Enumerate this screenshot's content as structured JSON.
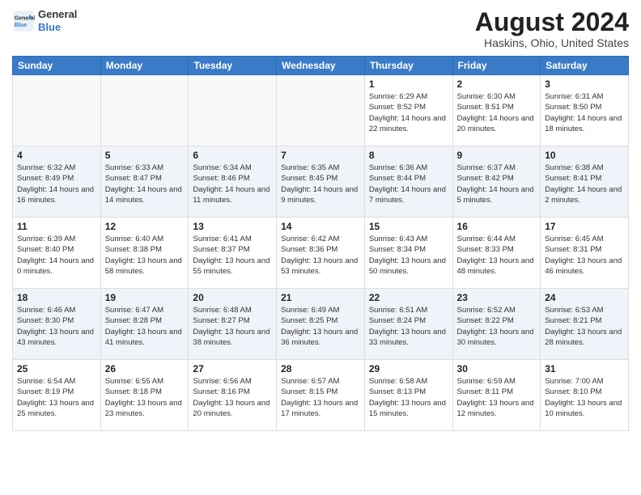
{
  "header": {
    "logo_line1": "General",
    "logo_line2": "Blue",
    "month_year": "August 2024",
    "location": "Haskins, Ohio, United States"
  },
  "day_headers": [
    "Sunday",
    "Monday",
    "Tuesday",
    "Wednesday",
    "Thursday",
    "Friday",
    "Saturday"
  ],
  "weeks": [
    [
      {
        "day": "",
        "info": ""
      },
      {
        "day": "",
        "info": ""
      },
      {
        "day": "",
        "info": ""
      },
      {
        "day": "",
        "info": ""
      },
      {
        "day": "1",
        "info": "Sunrise: 6:29 AM\nSunset: 8:52 PM\nDaylight: 14 hours\nand 22 minutes."
      },
      {
        "day": "2",
        "info": "Sunrise: 6:30 AM\nSunset: 8:51 PM\nDaylight: 14 hours\nand 20 minutes."
      },
      {
        "day": "3",
        "info": "Sunrise: 6:31 AM\nSunset: 8:50 PM\nDaylight: 14 hours\nand 18 minutes."
      }
    ],
    [
      {
        "day": "4",
        "info": "Sunrise: 6:32 AM\nSunset: 8:49 PM\nDaylight: 14 hours\nand 16 minutes."
      },
      {
        "day": "5",
        "info": "Sunrise: 6:33 AM\nSunset: 8:47 PM\nDaylight: 14 hours\nand 14 minutes."
      },
      {
        "day": "6",
        "info": "Sunrise: 6:34 AM\nSunset: 8:46 PM\nDaylight: 14 hours\nand 11 minutes."
      },
      {
        "day": "7",
        "info": "Sunrise: 6:35 AM\nSunset: 8:45 PM\nDaylight: 14 hours\nand 9 minutes."
      },
      {
        "day": "8",
        "info": "Sunrise: 6:36 AM\nSunset: 8:44 PM\nDaylight: 14 hours\nand 7 minutes."
      },
      {
        "day": "9",
        "info": "Sunrise: 6:37 AM\nSunset: 8:42 PM\nDaylight: 14 hours\nand 5 minutes."
      },
      {
        "day": "10",
        "info": "Sunrise: 6:38 AM\nSunset: 8:41 PM\nDaylight: 14 hours\nand 2 minutes."
      }
    ],
    [
      {
        "day": "11",
        "info": "Sunrise: 6:39 AM\nSunset: 8:40 PM\nDaylight: 14 hours\nand 0 minutes."
      },
      {
        "day": "12",
        "info": "Sunrise: 6:40 AM\nSunset: 8:38 PM\nDaylight: 13 hours\nand 58 minutes."
      },
      {
        "day": "13",
        "info": "Sunrise: 6:41 AM\nSunset: 8:37 PM\nDaylight: 13 hours\nand 55 minutes."
      },
      {
        "day": "14",
        "info": "Sunrise: 6:42 AM\nSunset: 8:36 PM\nDaylight: 13 hours\nand 53 minutes."
      },
      {
        "day": "15",
        "info": "Sunrise: 6:43 AM\nSunset: 8:34 PM\nDaylight: 13 hours\nand 50 minutes."
      },
      {
        "day": "16",
        "info": "Sunrise: 6:44 AM\nSunset: 8:33 PM\nDaylight: 13 hours\nand 48 minutes."
      },
      {
        "day": "17",
        "info": "Sunrise: 6:45 AM\nSunset: 8:31 PM\nDaylight: 13 hours\nand 46 minutes."
      }
    ],
    [
      {
        "day": "18",
        "info": "Sunrise: 6:46 AM\nSunset: 8:30 PM\nDaylight: 13 hours\nand 43 minutes."
      },
      {
        "day": "19",
        "info": "Sunrise: 6:47 AM\nSunset: 8:28 PM\nDaylight: 13 hours\nand 41 minutes."
      },
      {
        "day": "20",
        "info": "Sunrise: 6:48 AM\nSunset: 8:27 PM\nDaylight: 13 hours\nand 38 minutes."
      },
      {
        "day": "21",
        "info": "Sunrise: 6:49 AM\nSunset: 8:25 PM\nDaylight: 13 hours\nand 36 minutes."
      },
      {
        "day": "22",
        "info": "Sunrise: 6:51 AM\nSunset: 8:24 PM\nDaylight: 13 hours\nand 33 minutes."
      },
      {
        "day": "23",
        "info": "Sunrise: 6:52 AM\nSunset: 8:22 PM\nDaylight: 13 hours\nand 30 minutes."
      },
      {
        "day": "24",
        "info": "Sunrise: 6:53 AM\nSunset: 8:21 PM\nDaylight: 13 hours\nand 28 minutes."
      }
    ],
    [
      {
        "day": "25",
        "info": "Sunrise: 6:54 AM\nSunset: 8:19 PM\nDaylight: 13 hours\nand 25 minutes."
      },
      {
        "day": "26",
        "info": "Sunrise: 6:55 AM\nSunset: 8:18 PM\nDaylight: 13 hours\nand 23 minutes."
      },
      {
        "day": "27",
        "info": "Sunrise: 6:56 AM\nSunset: 8:16 PM\nDaylight: 13 hours\nand 20 minutes."
      },
      {
        "day": "28",
        "info": "Sunrise: 6:57 AM\nSunset: 8:15 PM\nDaylight: 13 hours\nand 17 minutes."
      },
      {
        "day": "29",
        "info": "Sunrise: 6:58 AM\nSunset: 8:13 PM\nDaylight: 13 hours\nand 15 minutes."
      },
      {
        "day": "30",
        "info": "Sunrise: 6:59 AM\nSunset: 8:11 PM\nDaylight: 13 hours\nand 12 minutes."
      },
      {
        "day": "31",
        "info": "Sunrise: 7:00 AM\nSunset: 8:10 PM\nDaylight: 13 hours\nand 10 minutes."
      }
    ]
  ]
}
